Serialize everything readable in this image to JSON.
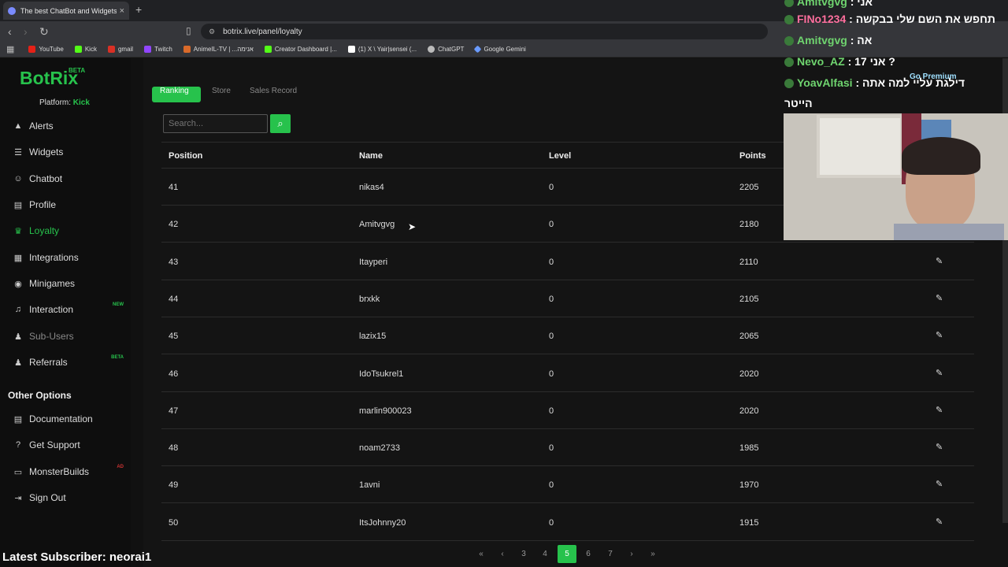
{
  "browser": {
    "tab_title": "The best ChatBot and Widgets f...",
    "url": "botrix.live/panel/loyalty",
    "bookmarks": [
      {
        "label": "YouTube",
        "color": "#e62117"
      },
      {
        "label": "Kick",
        "color": "#53fc18"
      },
      {
        "label": "gmail",
        "color": "#d93025"
      },
      {
        "label": "Twitch",
        "color": "#9146ff"
      },
      {
        "label": "AnimeIL-TV | ...אנימה",
        "color": "#d96a2a"
      },
      {
        "label": "Creator Dashboard |...",
        "color": "#53fc18"
      },
      {
        "label": "(1) X \\ Yair|sensei (...",
        "color": "#ffffff"
      },
      {
        "label": "ChatGPT",
        "color": "#bbbbbb"
      },
      {
        "label": "Google Gemini",
        "color": "#6a9bff"
      }
    ]
  },
  "sidebar": {
    "brand": "BotRix",
    "brand_badge": "BETA",
    "platform_label": "Platform:",
    "platform_value": "Kick",
    "items": [
      {
        "label": "Alerts",
        "icon": "warning-icon",
        "glyph": "▲"
      },
      {
        "label": "Widgets",
        "icon": "list-icon",
        "glyph": "☰"
      },
      {
        "label": "Chatbot",
        "icon": "robot-icon",
        "glyph": "☺"
      },
      {
        "label": "Profile",
        "icon": "profile-card-icon",
        "glyph": "▤"
      },
      {
        "label": "Loyalty",
        "icon": "trophy-icon",
        "glyph": "♛"
      },
      {
        "label": "Integrations",
        "icon": "integrations-icon",
        "glyph": "▦"
      },
      {
        "label": "Minigames",
        "icon": "gamepad-icon",
        "glyph": "◉"
      },
      {
        "label": "Interaction",
        "icon": "music-icon",
        "glyph": "♫",
        "badge": "NEW"
      },
      {
        "label": "Sub-Users",
        "icon": "users-icon",
        "glyph": "♟"
      },
      {
        "label": "Referrals",
        "icon": "referrals-icon",
        "glyph": "♟",
        "badge": "BETA"
      }
    ],
    "other_heading": "Other Options",
    "other_items": [
      {
        "label": "Documentation",
        "icon": "book-icon",
        "glyph": "▤"
      },
      {
        "label": "Get Support",
        "icon": "help-icon",
        "glyph": "?"
      },
      {
        "label": "MonsterBuilds",
        "icon": "laptop-icon",
        "glyph": "▭",
        "badge": "AD"
      },
      {
        "label": "Sign Out",
        "icon": "sign-out-icon",
        "glyph": "⇥"
      }
    ]
  },
  "loyalty": {
    "tabs": [
      "Ranking",
      "Store",
      "Sales Record"
    ],
    "search_placeholder": "Search...",
    "columns": [
      "Position",
      "Name",
      "Level",
      "Points"
    ],
    "rows": [
      {
        "position": "41",
        "name": "nikas4",
        "level": "0",
        "points": "2205"
      },
      {
        "position": "42",
        "name": "Amitvgvg",
        "level": "0",
        "points": "2180"
      },
      {
        "position": "43",
        "name": "Itayperi",
        "level": "0",
        "points": "2110"
      },
      {
        "position": "44",
        "name": "brxkk",
        "level": "0",
        "points": "2105"
      },
      {
        "position": "45",
        "name": "lazix15",
        "level": "0",
        "points": "2065"
      },
      {
        "position": "46",
        "name": "IdoTsukrel1",
        "level": "0",
        "points": "2020"
      },
      {
        "position": "47",
        "name": "marlin900023",
        "level": "0",
        "points": "2020"
      },
      {
        "position": "48",
        "name": "noam2733",
        "level": "0",
        "points": "1985"
      },
      {
        "position": "49",
        "name": "1avni",
        "level": "0",
        "points": "1970"
      },
      {
        "position": "50",
        "name": "ItsJohnny20",
        "level": "0",
        "points": "1915"
      }
    ],
    "pagination": {
      "first": "«",
      "prev": "‹",
      "pages": [
        "3",
        "4",
        "5",
        "6",
        "7"
      ],
      "current": "5",
      "next": "›",
      "last": "»"
    }
  },
  "stream_overlay": {
    "latest_subscriber": "Latest Subscriber: neorai1",
    "chat": [
      {
        "user": "Amitvgvg",
        "message": ": אני"
      },
      {
        "user": "FINo1234",
        "message": ": תחפש את השם שלי בבקשה"
      },
      {
        "user": "Amitvgvg",
        "message": ": אה"
      },
      {
        "user": "Nevo_AZ",
        "message": ": אני 17 ?"
      },
      {
        "user": "YoavAlfasi",
        "message": ": דילגת עליי למה אתה"
      },
      {
        "user": "",
        "message": "הייטר"
      }
    ],
    "go_premium": "Go Premium"
  }
}
